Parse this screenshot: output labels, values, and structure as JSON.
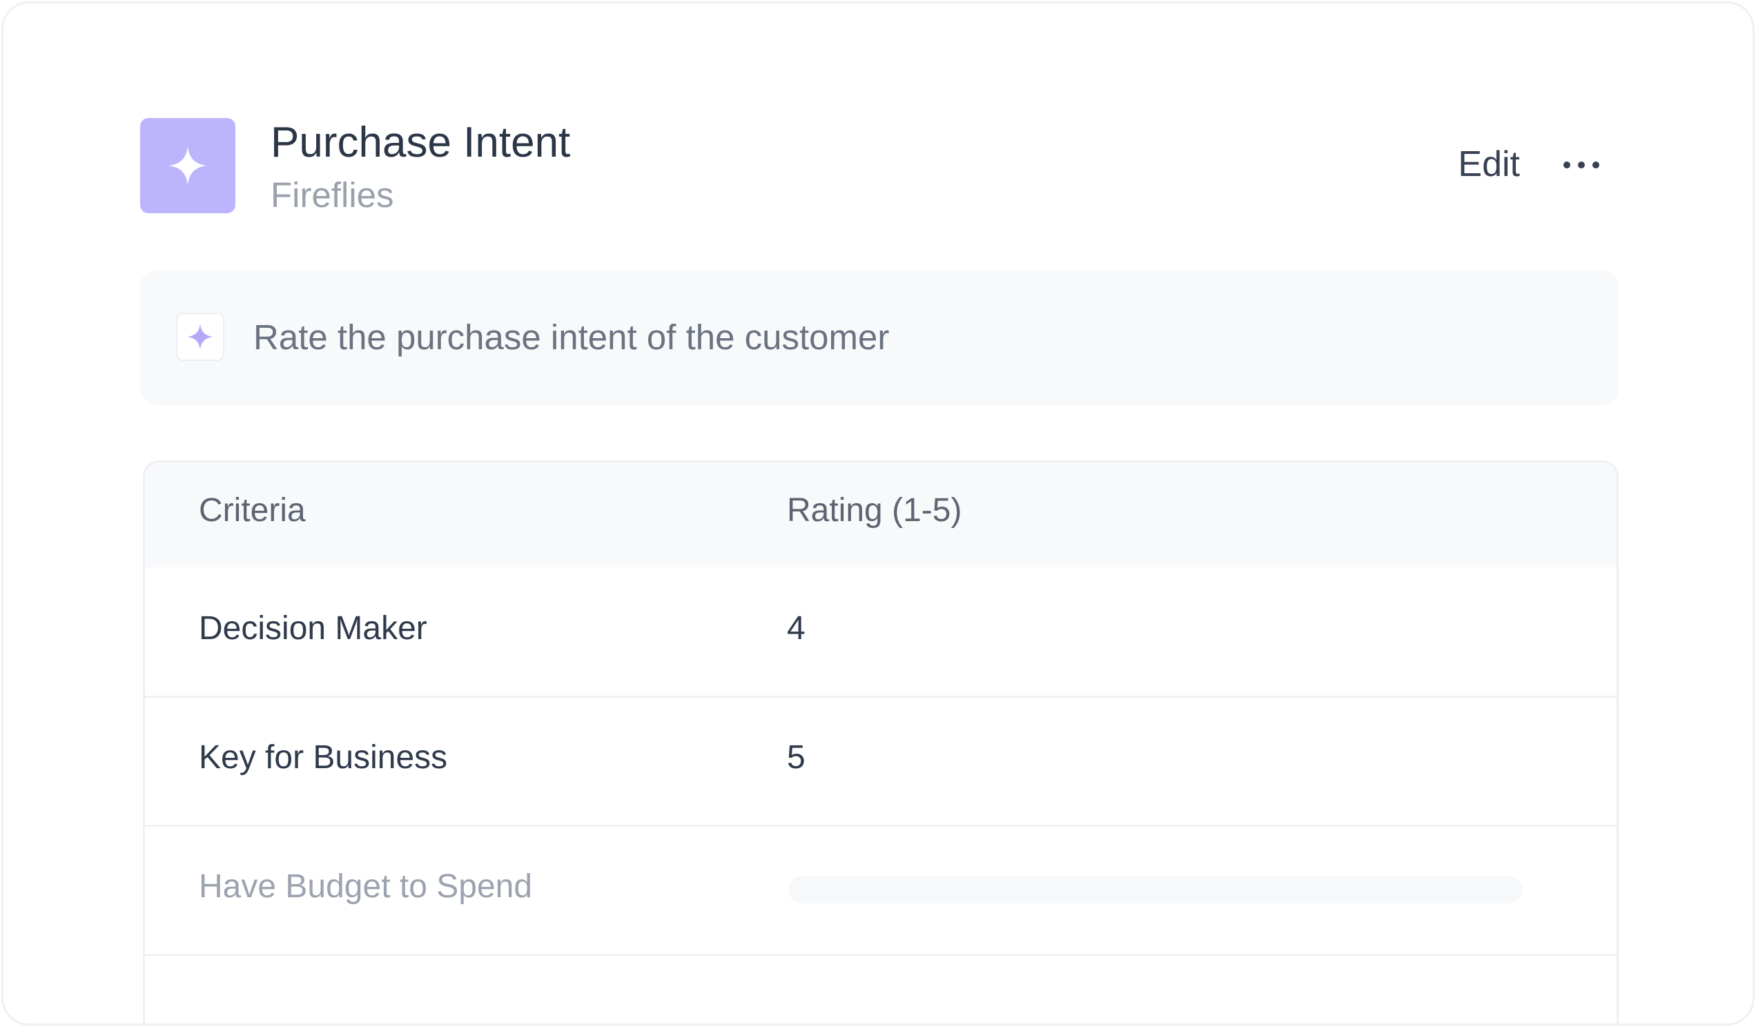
{
  "card": {
    "title": "Purchase Intent",
    "subtitle": "Fireflies",
    "icon": "sparkle-icon",
    "accent_color": "#bdb5fc"
  },
  "actions": {
    "edit_label": "Edit",
    "more_icon": "more-horizontal-icon"
  },
  "prompt": {
    "icon": "sparkle-icon",
    "text": "Rate the purchase intent of the customer"
  },
  "table": {
    "columns": [
      "Criteria",
      "Rating (1-5)"
    ],
    "rows": [
      {
        "criteria": "Decision Maker",
        "rating": "4"
      },
      {
        "criteria": "Key for Business",
        "rating": "5"
      },
      {
        "criteria": "Have Budget to Spend",
        "rating": ""
      }
    ]
  }
}
